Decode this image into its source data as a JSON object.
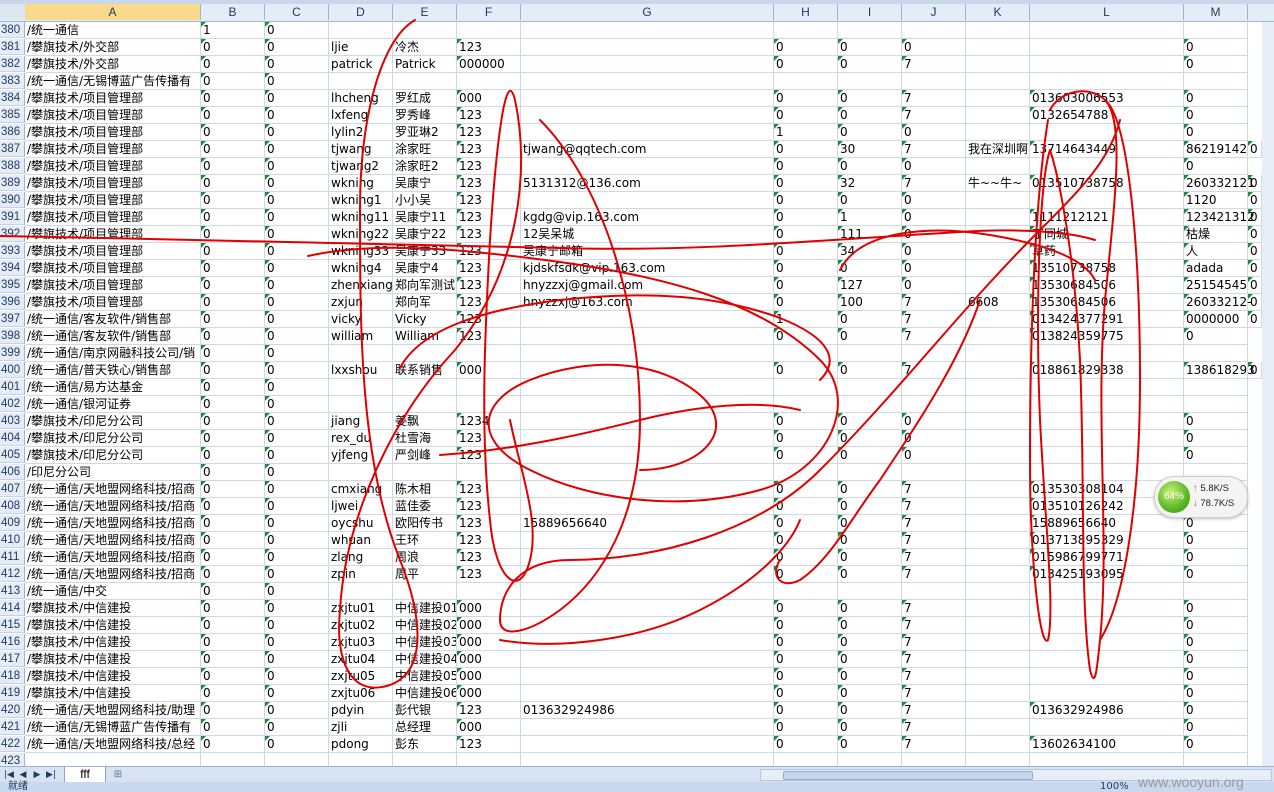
{
  "columns": [
    "A",
    "B",
    "C",
    "D",
    "E",
    "F",
    "G",
    "H",
    "I",
    "J",
    "K",
    "L",
    "M"
  ],
  "selected_column": "A",
  "rows": [
    {
      "n": "380",
      "A": "/统一通信",
      "B": "1",
      "C": "0"
    },
    {
      "n": "381",
      "A": "/攀旗技术/外交部",
      "B": "0",
      "C": "0",
      "D": "ljie",
      "E": "冷杰",
      "F": "123",
      "H": "0",
      "I": "0",
      "J": "0",
      "M": "0"
    },
    {
      "n": "382",
      "A": "/攀旗技术/外交部",
      "B": "0",
      "C": "0",
      "D": "patrick",
      "E": "Patrick",
      "F": "000000",
      "H": "0",
      "I": "0",
      "J": "7",
      "M": "0"
    },
    {
      "n": "383",
      "A": "/统一通信/无锡博蓝广告传播有",
      "B": "0",
      "C": "0"
    },
    {
      "n": "384",
      "A": "/攀旗技术/项目管理部",
      "B": "0",
      "C": "0",
      "D": "lhcheng",
      "E": "罗红成",
      "F": "000",
      "H": "0",
      "I": "0",
      "J": "7",
      "L": "013603006553",
      "M": "0"
    },
    {
      "n": "385",
      "A": "/攀旗技术/项目管理部",
      "B": "0",
      "C": "0",
      "D": "lxfeng",
      "E": "罗秀峰",
      "F": "123",
      "H": "0",
      "I": "0",
      "J": "7",
      "L": "0132654788",
      "M": "0"
    },
    {
      "n": "386",
      "A": "/攀旗技术/项目管理部",
      "B": "0",
      "C": "0",
      "D": "lylin2",
      "E": "罗亚琳2",
      "F": "123",
      "H": "1",
      "I": "0",
      "J": "0",
      "M": "0"
    },
    {
      "n": "387",
      "A": "/攀旗技术/项目管理部",
      "B": "0",
      "C": "0",
      "D": "tjwang",
      "E": "涂家旺",
      "F": "123",
      "G": "tjwang@qqtech.com",
      "H": "0",
      "I": "30",
      "J": "7",
      "K": "我在深圳啊",
      "L": "13714643449",
      "M": "86219142",
      "M2": "0"
    },
    {
      "n": "388",
      "A": "/攀旗技术/项目管理部",
      "B": "0",
      "C": "0",
      "D": "tjwang2",
      "E": "涂家旺2",
      "F": "123",
      "H": "0",
      "I": "0",
      "J": "0",
      "M": "0"
    },
    {
      "n": "389",
      "A": "/攀旗技术/项目管理部",
      "B": "0",
      "C": "0",
      "D": "wkning",
      "E": "吴康宁",
      "F": "123",
      "G": "5131312@136.com",
      "H": "0",
      "I": "32",
      "J": "7",
      "K": "牛~~牛~",
      "L": "013510738758",
      "M": "260332121",
      "M2": "0"
    },
    {
      "n": "390",
      "A": "/攀旗技术/项目管理部",
      "B": "0",
      "C": "0",
      "D": "wkning1",
      "E": "小小吴",
      "F": "123",
      "H": "0",
      "I": "0",
      "J": "0",
      "M": "1120",
      "M2": "0"
    },
    {
      "n": "391",
      "A": "/攀旗技术/项目管理部",
      "B": "0",
      "C": "0",
      "D": "wkning11",
      "E": "吴康宁11",
      "F": "123",
      "G": "kgdg@vip.163.com",
      "H": "0",
      "I": "1",
      "J": "0",
      "L": "1111212121",
      "M": "123421312",
      "M2": "0"
    },
    {
      "n": "392",
      "A": "/攀旗技术/项目管理部",
      "B": "0",
      "C": "0",
      "D": "wkning22",
      "E": "吴康宁22",
      "F": "123",
      "G": "12吴呆城",
      "H": "0",
      "I": "111",
      "J": "0",
      "L": "丁同城",
      "M": "枯燥",
      "M2": "0"
    },
    {
      "n": "393",
      "A": "/攀旗技术/项目管理部",
      "B": "0",
      "C": "0",
      "D": "wkning33",
      "E": "吴康宁33",
      "F": "123",
      "G": "吴康宁邮箱",
      "H": "0",
      "I": "34",
      "J": "0",
      "L": "草药",
      "M": "人",
      "M2": "0"
    },
    {
      "n": "394",
      "A": "/攀旗技术/项目管理部",
      "B": "0",
      "C": "0",
      "D": "wkning4",
      "E": "吴康宁4",
      "F": "123",
      "G": "kjdskfsdk@vip.163.com",
      "H": "0",
      "I": "0",
      "J": "0",
      "L": "13510738758",
      "M": "adada",
      "M2": "0"
    },
    {
      "n": "395",
      "A": "/攀旗技术/项目管理部",
      "B": "0",
      "C": "0",
      "D": "zhenxiang",
      "E": "郑向军测试",
      "F": "123",
      "G": "hnyzzxj@gmail.com",
      "H": "0",
      "I": "127",
      "J": "0",
      "L": "13530684506",
      "M": "25154545",
      "M2": "0"
    },
    {
      "n": "396",
      "A": "/攀旗技术/项目管理部",
      "B": "0",
      "C": "0",
      "D": "zxjun",
      "E": "郑向军",
      "F": "123",
      "G": "hnyzzxj@163.com",
      "H": "0",
      "I": "100",
      "J": "7",
      "K": "6608",
      "L": "13530684506",
      "M": "26033212-",
      "M2": "0"
    },
    {
      "n": "397",
      "A": "/统一通信/客友软件/销售部",
      "B": "0",
      "C": "0",
      "D": "vicky",
      "E": "Vicky",
      "F": "123",
      "H": "1",
      "I": "0",
      "J": "7",
      "L": "013424377291",
      "M": "0000000",
      "M2": "0"
    },
    {
      "n": "398",
      "A": "/统一通信/客友软件/销售部",
      "B": "0",
      "C": "0",
      "D": "william",
      "E": "William",
      "F": "123",
      "H": "0",
      "I": "0",
      "J": "7",
      "L": "013824359775",
      "M": "0"
    },
    {
      "n": "399",
      "A": "/统一通信/南京网融科技公司/销",
      "B": "0",
      "C": "0"
    },
    {
      "n": "400",
      "A": "/统一通信/普天铁心/销售部",
      "B": "0",
      "C": "0",
      "D": "lxxshou",
      "E": "联系销售",
      "F": "000",
      "H": "0",
      "I": "0",
      "J": "7",
      "L": "018861829338",
      "M": "138618293",
      "M2": "0"
    },
    {
      "n": "401",
      "A": "/统一通信/易方达基金",
      "B": "0",
      "C": "0"
    },
    {
      "n": "402",
      "A": "/统一通信/银河证券",
      "B": "0",
      "C": "0"
    },
    {
      "n": "403",
      "A": "/攀旗技术/印尼分公司",
      "B": "0",
      "C": "0",
      "D": "jiang",
      "E": "姜飘",
      "F": "1234",
      "H": "0",
      "I": "0",
      "J": "0",
      "M": "0"
    },
    {
      "n": "404",
      "A": "/攀旗技术/印尼分公司",
      "B": "0",
      "C": "0",
      "D": "rex_du",
      "E": "杜雪海",
      "F": "123",
      "H": "0",
      "I": "0",
      "J": "0",
      "M": "0"
    },
    {
      "n": "405",
      "A": "/攀旗技术/印尼分公司",
      "B": "0",
      "C": "0",
      "D": "yjfeng",
      "E": "严剑峰",
      "F": "123",
      "H": "0",
      "I": "0",
      "J": "0",
      "M": "0"
    },
    {
      "n": "406",
      "A": "/印尼分公司",
      "B": "0",
      "C": "0"
    },
    {
      "n": "407",
      "A": "/统一通信/天地盟网络科技/招商",
      "B": "0",
      "C": "0",
      "D": "cmxiang",
      "E": "陈木相",
      "F": "123",
      "H": "0",
      "I": "0",
      "J": "7",
      "L": "013530308104",
      "M": "0"
    },
    {
      "n": "408",
      "A": "/统一通信/天地盟网络科技/招商",
      "B": "0",
      "C": "0",
      "D": "ljwei",
      "E": "蓝佳委",
      "F": "123",
      "H": "0",
      "I": "0",
      "J": "7",
      "L": "013510126242",
      "M": "0"
    },
    {
      "n": "409",
      "A": "/统一通信/天地盟网络科技/招商",
      "B": "0",
      "C": "0",
      "D": "oycshu",
      "E": "欧阳传书",
      "F": "123",
      "G": "15889656640",
      "H": "0",
      "I": "0",
      "J": "7",
      "L": "15889656640",
      "M": "0"
    },
    {
      "n": "410",
      "A": "/统一通信/天地盟网络科技/招商",
      "B": "0",
      "C": "0",
      "D": "whuan",
      "E": "王环",
      "F": "123",
      "H": "0",
      "I": "0",
      "J": "7",
      "L": "013713895329",
      "M": "0"
    },
    {
      "n": "411",
      "A": "/统一通信/天地盟网络科技/招商",
      "B": "0",
      "C": "0",
      "D": "zlang",
      "E": "周浪",
      "F": "123",
      "H": "0",
      "I": "0",
      "J": "7",
      "L": "015986799771",
      "M": "0"
    },
    {
      "n": "412",
      "A": "/统一通信/天地盟网络科技/招商",
      "B": "0",
      "C": "0",
      "D": "zpin",
      "E": "周平",
      "F": "123",
      "H": "0",
      "I": "0",
      "J": "7",
      "L": "013425193095",
      "M": "0"
    },
    {
      "n": "413",
      "A": "/统一通信/中交",
      "B": "0",
      "C": "0"
    },
    {
      "n": "414",
      "A": "/攀旗技术/中信建投",
      "B": "0",
      "C": "0",
      "D": "zxjtu01",
      "E": "中信建投01",
      "F": "000",
      "H": "0",
      "I": "0",
      "J": "7",
      "M": "0"
    },
    {
      "n": "415",
      "A": "/攀旗技术/中信建投",
      "B": "0",
      "C": "0",
      "D": "zxjtu02",
      "E": "中信建投02",
      "F": "000",
      "H": "0",
      "I": "0",
      "J": "7",
      "M": "0"
    },
    {
      "n": "416",
      "A": "/攀旗技术/中信建投",
      "B": "0",
      "C": "0",
      "D": "zxjtu03",
      "E": "中信建投03",
      "F": "000",
      "H": "0",
      "I": "0",
      "J": "7",
      "M": "0"
    },
    {
      "n": "417",
      "A": "/攀旗技术/中信建投",
      "B": "0",
      "C": "0",
      "D": "zxjtu04",
      "E": "中信建投04",
      "F": "000",
      "H": "0",
      "I": "0",
      "J": "7",
      "M": "0"
    },
    {
      "n": "418",
      "A": "/攀旗技术/中信建投",
      "B": "0",
      "C": "0",
      "D": "zxjtu05",
      "E": "中信建投05",
      "F": "000",
      "H": "0",
      "I": "0",
      "J": "7",
      "M": "0"
    },
    {
      "n": "419",
      "A": "/攀旗技术/中信建投",
      "B": "0",
      "C": "0",
      "D": "zxjtu06",
      "E": "中信建投06",
      "F": "000",
      "H": "0",
      "I": "0",
      "J": "7",
      "M": "0"
    },
    {
      "n": "420",
      "A": "/统一通信/天地盟网络科技/助理",
      "B": "0",
      "C": "0",
      "D": "pdyin",
      "E": "彭代银",
      "F": "123",
      "G": "013632924986",
      "H": "0",
      "I": "0",
      "J": "7",
      "L": "013632924986",
      "M": "0"
    },
    {
      "n": "421",
      "A": "/统一通信/无锡博蓝广告传播有",
      "B": "0",
      "C": "0",
      "D": "zjli",
      "E": "总经理",
      "F": "000",
      "H": "0",
      "I": "0",
      "J": "7",
      "M": "0"
    },
    {
      "n": "422",
      "A": "/统一通信/天地盟网络科技/总经",
      "B": "0",
      "C": "0",
      "D": "pdong",
      "E": "彭东",
      "F": "123",
      "H": "0",
      "I": "0",
      "J": "7",
      "L": "13602634100",
      "M": "0"
    },
    {
      "n": "423"
    }
  ],
  "sheet_tab": "fff",
  "network_widget": {
    "percent": "64%",
    "upload": "5.8K/S",
    "download": "78.7K/S"
  },
  "statusbar": {
    "left": "就绪",
    "zoom": "100%"
  },
  "watermark": "www.wooyun.org",
  "colors": {
    "ink": "#e00000",
    "header_bg": "#e4ecf7",
    "grid_line": "#d0d7e5",
    "marker": "#1f8a3a"
  }
}
